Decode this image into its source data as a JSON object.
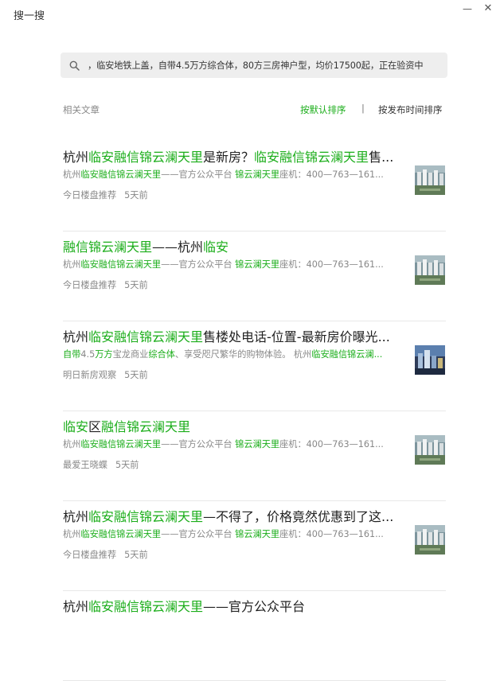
{
  "window": {
    "title": "搜一搜",
    "minimize_icon": "minimize-icon",
    "close_icon": "close-icon"
  },
  "search": {
    "icon": "search-icon",
    "query": "，临安地铁上盖，自带4.5万方综合体，80方三房神户型，均价17500起，正在验资中"
  },
  "list_header": {
    "label": "相关文章",
    "sort_default": "按默认排序",
    "divider": "|",
    "sort_time": "按发布时间排序"
  },
  "colors": {
    "accent": "#1aad19",
    "muted": "#888888",
    "title": "#222222"
  },
  "results": [
    {
      "title_segments": [
        {
          "text": "杭州",
          "hl": false
        },
        {
          "text": "临安融信锦云澜天里",
          "hl": true
        },
        {
          "text": "是新房？",
          "hl": false
        },
        {
          "text": "临安融信锦云澜天里",
          "hl": true
        },
        {
          "text": "售...",
          "hl": false
        }
      ],
      "desc_segments": [
        {
          "text": "杭州",
          "hl": false
        },
        {
          "text": "临安融信锦云澜天里",
          "hl": true
        },
        {
          "text": "——官方公众平台 ",
          "hl": false
        },
        {
          "text": "锦云澜天里",
          "hl": true
        },
        {
          "text": "座机：400—763—161...",
          "hl": false
        }
      ],
      "source": "今日楼盘推荐",
      "date": "5天前",
      "thumb": "building-aerial-image"
    },
    {
      "title_segments": [
        {
          "text": "融信锦云澜天里",
          "hl": true
        },
        {
          "text": "——杭州",
          "hl": false
        },
        {
          "text": "临安",
          "hl": true
        }
      ],
      "desc_segments": [
        {
          "text": "杭州",
          "hl": false
        },
        {
          "text": "临安融信锦云澜天里",
          "hl": true
        },
        {
          "text": "——官方公众平台 ",
          "hl": false
        },
        {
          "text": "锦云澜天里",
          "hl": true
        },
        {
          "text": "座机：400—763—161...",
          "hl": false
        }
      ],
      "source": "今日楼盘推荐",
      "date": "5天前",
      "thumb": "building-aerial-image"
    },
    {
      "title_segments": [
        {
          "text": "杭州",
          "hl": false
        },
        {
          "text": "临安融信锦云澜天里",
          "hl": true
        },
        {
          "text": "售楼处电话-位置-最新房价曝光...",
          "hl": false
        }
      ],
      "desc_segments": [
        {
          "text": "自带",
          "hl": true
        },
        {
          "text": "4.5",
          "hl": false
        },
        {
          "text": "万方",
          "hl": true
        },
        {
          "text": "宝龙商业",
          "hl": false
        },
        {
          "text": "综合体",
          "hl": true
        },
        {
          "text": "、享受咫尺繁华的购物体验。 杭州",
          "hl": false
        },
        {
          "text": "临安融信锦云澜...",
          "hl": true
        }
      ],
      "source": "明日新房观察",
      "date": "5天前",
      "thumb": "city-night-image"
    },
    {
      "title_segments": [
        {
          "text": "临安",
          "hl": true
        },
        {
          "text": "区",
          "hl": false
        },
        {
          "text": "融信锦云澜天里",
          "hl": true
        }
      ],
      "desc_segments": [
        {
          "text": "杭州",
          "hl": false
        },
        {
          "text": "临安融信锦云澜天里",
          "hl": true
        },
        {
          "text": "——官方公众平台 ",
          "hl": false
        },
        {
          "text": "锦云澜天里",
          "hl": true
        },
        {
          "text": "座机：400—763—161...",
          "hl": false
        }
      ],
      "source": "最爱王晓蝶",
      "date": "5天前",
      "thumb": "building-aerial-image"
    },
    {
      "title_segments": [
        {
          "text": "杭州",
          "hl": false
        },
        {
          "text": "临安融信锦云澜天里",
          "hl": true
        },
        {
          "text": "—不得了，价格竟然优惠到了这...",
          "hl": false
        }
      ],
      "desc_segments": [
        {
          "text": "杭州",
          "hl": false
        },
        {
          "text": "临安融信锦云澜天里",
          "hl": true
        },
        {
          "text": "——官方公众平台 ",
          "hl": false
        },
        {
          "text": "锦云澜天里",
          "hl": true
        },
        {
          "text": "座机：400—763—161...",
          "hl": false
        }
      ],
      "source": "今日楼盘推荐",
      "date": "5天前",
      "thumb": "building-aerial-image"
    },
    {
      "title_segments": [
        {
          "text": "杭州",
          "hl": false
        },
        {
          "text": "临安融信锦云澜天里",
          "hl": true
        },
        {
          "text": "——官方公众平台",
          "hl": false
        }
      ],
      "desc_segments": [],
      "source": "",
      "date": "",
      "thumb": ""
    }
  ]
}
